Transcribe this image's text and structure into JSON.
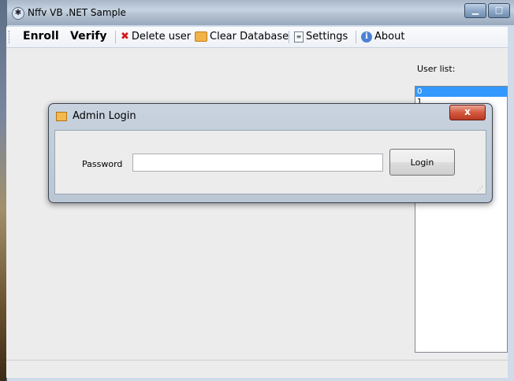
{
  "window": {
    "title": "Nffv VB .NET Sample",
    "controls": {
      "minimize": "▁",
      "maximize": "□"
    }
  },
  "toolbar": {
    "items": [
      {
        "label": "Enroll",
        "icon": ""
      },
      {
        "label": "Verify",
        "icon": ""
      },
      {
        "label": "Delete user",
        "icon": "red-x-icon"
      },
      {
        "label": "Clear Database",
        "icon": "database-clear-icon"
      },
      {
        "label": "Settings",
        "icon": "settings-icon"
      },
      {
        "label": "About",
        "icon": "info-icon"
      }
    ]
  },
  "user_list": {
    "label": "User list:",
    "items": [
      "0",
      "1"
    ],
    "selected_index": 0
  },
  "dialog": {
    "title": "Admin Login",
    "close_glyph": "x",
    "password_label": "Password",
    "password_value": "",
    "login_label": "Login"
  },
  "colors": {
    "selection": "#3399ff",
    "close_button": "#d45a40"
  }
}
